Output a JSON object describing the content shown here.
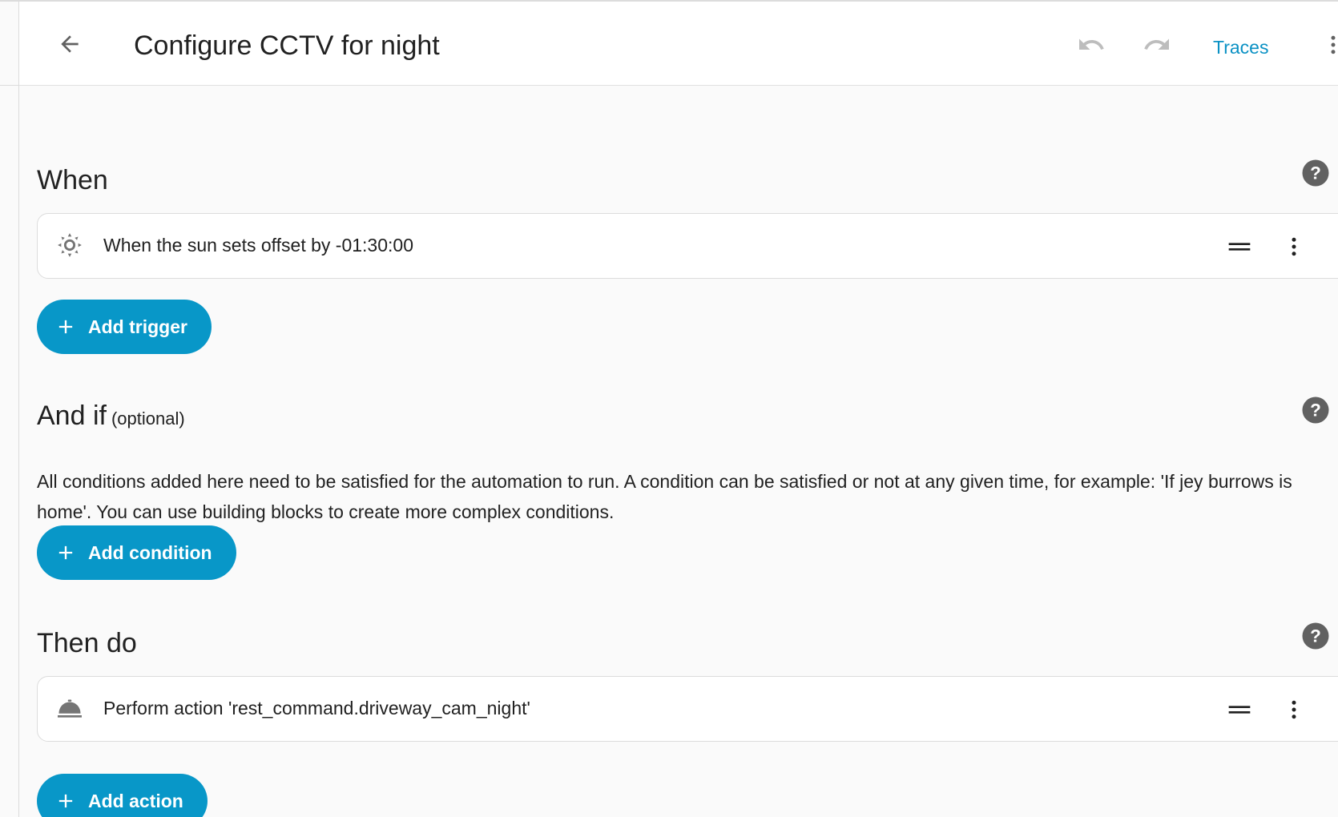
{
  "header": {
    "title": "Configure CCTV for night",
    "traces_label": "Traces",
    "icons": {
      "back": "arrow-left-icon",
      "undo": "undo-icon",
      "redo": "redo-icon",
      "more": "dots-vertical-icon"
    }
  },
  "colors": {
    "accent": "#0897c8",
    "link": "#0a91c4",
    "background": "#fafafa",
    "card": "#ffffff",
    "icon_gray": "#757575"
  },
  "triggers": {
    "heading": "When",
    "items": [
      {
        "text": "When the sun sets offset by -01:30:00",
        "icon": "sun-icon"
      }
    ],
    "add_label": "Add trigger"
  },
  "conditions": {
    "heading": "And if",
    "optional_label": "(optional)",
    "description": "All conditions added here need to be satisfied for the automation to run. A condition can be satisfied or not at any given time, for example: 'If jey burrows is home'. You can use building blocks to create more complex conditions.",
    "add_label": "Add condition"
  },
  "actions": {
    "heading": "Then do",
    "items": [
      {
        "text": "Perform action 'rest_command.driveway_cam_night'",
        "icon": "room-service-icon"
      }
    ],
    "add_label": "Add action"
  }
}
